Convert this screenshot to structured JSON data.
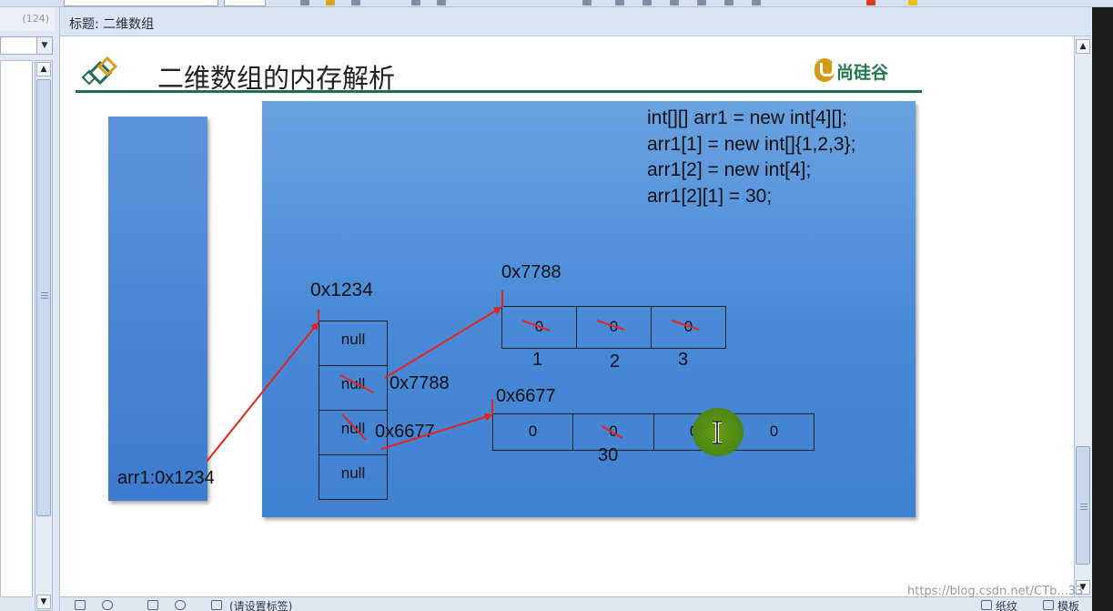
{
  "window": {
    "title_label": "标题:",
    "title_value": "二维数组"
  },
  "left_pane": {
    "count": "(124)"
  },
  "slide": {
    "title": "二维数组的内存解析",
    "brand": "尚硅谷",
    "code_lines": [
      "int[][] arr1 = new int[4][];",
      "arr1[1] = new int[]{1,2,3};",
      "arr1[2] = new int[4];",
      "arr1[2][1] = 30;"
    ],
    "stack_label": "arr1:0x1234",
    "outer_array": {
      "address": "0x1234",
      "cells": [
        "null",
        "null",
        "null",
        "null"
      ]
    },
    "array_a": {
      "address": "0x7788",
      "ref_label": "0x7788",
      "cells": [
        "0",
        "0",
        "0"
      ],
      "new_values": [
        "1",
        "2",
        "3"
      ]
    },
    "array_b": {
      "address": "0x6677",
      "ref_label": "0x6677",
      "cells": [
        "0",
        "0",
        "0",
        "0"
      ],
      "new_value": "30"
    }
  },
  "status_bar": {
    "tag_prompt": "(请设置标签)",
    "paper_label": "纸纹",
    "template_label": "模板"
  },
  "watermark": "https://blog.csdn.net/CTb...33",
  "colors": {
    "accent_green": "#1f6d53",
    "arrow_red": "#e8231f",
    "box_blue": "#4a8bd8"
  }
}
